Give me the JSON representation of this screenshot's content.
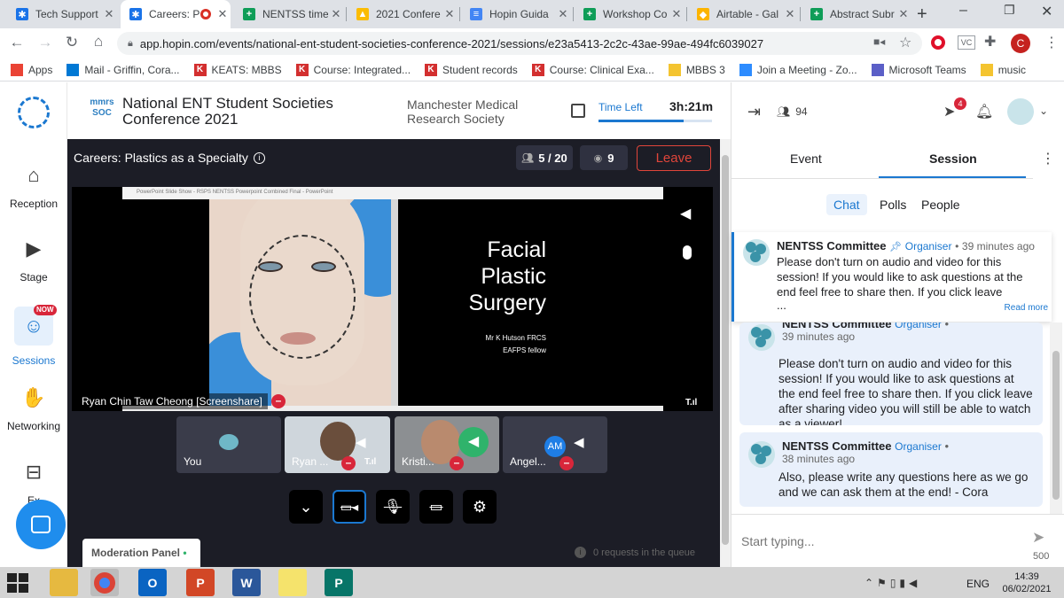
{
  "browser": {
    "tabs": [
      {
        "title": "Tech Support",
        "color": "#1a73e8",
        "glyph": "✱"
      },
      {
        "title": "Careers: P",
        "color": "#1a73e8",
        "glyph": "✱",
        "active": true
      },
      {
        "title": "NENTSS time",
        "color": "#0f9d58",
        "glyph": "+"
      },
      {
        "title": "2021 Confere",
        "color": "#fbbc04",
        "glyph": "▲"
      },
      {
        "title": "Hopin Guida",
        "color": "#4285f4",
        "glyph": "≡"
      },
      {
        "title": "Workshop Co",
        "color": "#0f9d58",
        "glyph": "+"
      },
      {
        "title": "Airtable - Gal",
        "color": "#fcb400",
        "glyph": "◆"
      },
      {
        "title": "Abstract Subr",
        "color": "#0f9d58",
        "glyph": "+"
      }
    ],
    "new_tab": "+",
    "url": "app.hopin.com/events/national-ent-student-societies-conference-2021/sessions/e23a5413-2c2c-43ae-99ae-494fc6039027",
    "profile_initial": "C",
    "ext_vc": "VC",
    "bookmarks": [
      {
        "label": "Apps",
        "color": "#ea4335"
      },
      {
        "label": "Mail - Griffin, Cora...",
        "color": "#0078d4"
      },
      {
        "label": "KEATS: MBBS",
        "color": "#d32f2f",
        "glyph": "K"
      },
      {
        "label": "Course: Integrated...",
        "color": "#d32f2f",
        "glyph": "K"
      },
      {
        "label": "Student records",
        "color": "#d32f2f",
        "glyph": "K"
      },
      {
        "label": "Course: Clinical Exa...",
        "color": "#d32f2f",
        "glyph": "K"
      },
      {
        "label": "MBBS 3",
        "color": "#f4c430"
      },
      {
        "label": "Join a Meeting - Zo...",
        "color": "#2d8cff"
      },
      {
        "label": "Microsoft Teams",
        "color": "#5b5fc7"
      },
      {
        "label": "music",
        "color": "#f4c430"
      }
    ]
  },
  "hopin": {
    "nav": [
      {
        "label": "Reception",
        "icon": "home-icon"
      },
      {
        "label": "Stage",
        "icon": "camera-icon"
      },
      {
        "label": "Sessions",
        "icon": "people-icon",
        "badge": "NOW"
      },
      {
        "label": "Networking",
        "icon": "handshake-icon"
      },
      {
        "label": "Ex",
        "icon": "store-icon"
      }
    ],
    "event_logo": "mmrs SOC",
    "event_title_1": "National ENT Student Societies",
    "event_title_2": "Conference 2021",
    "organizer_1": "Manchester Medical",
    "organizer_2": "Research Society",
    "time_left_label": "Time Left",
    "time_left_value": "3h:21m",
    "time_progress": 0.75,
    "session_title": "Careers: Plastics as a Specialty",
    "participants": "5 / 20",
    "viewers": "9",
    "leave_label": "Leave",
    "screenshare_name": "Ryan Chin Taw Cheong [Screenshare]",
    "slide": {
      "window_title": "PowerPoint Slide Show - RSPS NENTSS Powerpoint Combined Final - PowerPoint",
      "title_1": "Facial",
      "title_2": "Plastic",
      "title_3": "Surgery",
      "speaker": "Mr K Hutson FRCS",
      "role": "EAFPS fellow"
    },
    "tiles": [
      {
        "name": "You"
      },
      {
        "name": "Ryan ..."
      },
      {
        "name": "Kristi..."
      },
      {
        "name": "Angel...",
        "initials": "AM"
      }
    ],
    "moderation_label": "Moderation Panel",
    "queue_text": "0 requests in the queue"
  },
  "panel": {
    "attendees": "94",
    "notif_count": "4",
    "tabs": [
      "Event",
      "Session"
    ],
    "subtabs": [
      "Chat",
      "Polls",
      "People"
    ],
    "pinned": {
      "author": "NENTSS Committee",
      "role": "Organiser",
      "time": "39 minutes ago",
      "text": "Please don't turn on audio and video for this session! If you would like to ask questions at the end feel free to share then. If you click leave",
      "more": "...",
      "read_more": "Read more"
    },
    "messages": [
      {
        "author": "NENTSS Committee",
        "role": "Organiser",
        "time": "39 minutes ago",
        "text": "Please don't turn on audio and video for this session! If you would like to ask questions at the end feel free to share then. If you click leave after sharing video you will still be able to watch as a viewer!"
      },
      {
        "author": "NENTSS Committee",
        "role": "Organiser",
        "time": "38 minutes ago",
        "text": "Also, please write any questions here as we go and we can ask them at the end! - Cora"
      }
    ],
    "input_placeholder": "Start typing...",
    "char_limit": "500"
  },
  "taskbar": {
    "lang": "ENG",
    "time": "14:39",
    "date": "06/02/2021"
  }
}
